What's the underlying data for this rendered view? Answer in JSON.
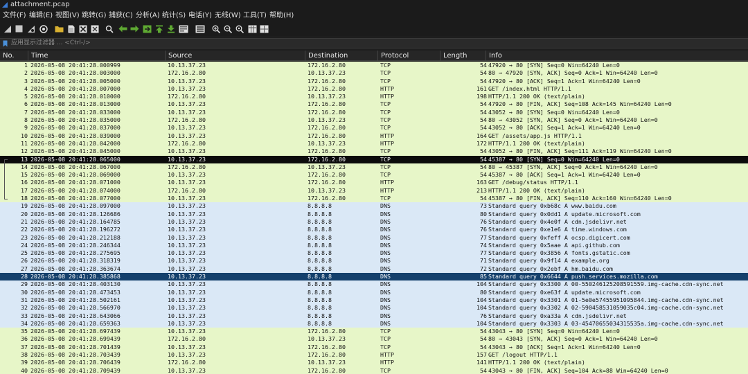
{
  "window": {
    "title": "attachment.pcap"
  },
  "menu": [
    "文件(F)",
    "编辑(E)",
    "视图(V)",
    "跳转(G)",
    "捕获(C)",
    "分析(A)",
    "统计(S)",
    "电话(Y)",
    "无线(W)",
    "工具(T)",
    "帮助(H)"
  ],
  "toolbar": {
    "icons": [
      "shark-fin-start-icon",
      "stop-icon",
      "restart-icon",
      "capture-options-icon",
      "open-folder-icon",
      "file-icon",
      "save-icon",
      "close-file-icon",
      "reload-icon",
      "find-icon",
      "back-arrow-icon",
      "forward-arrow-icon",
      "go-to-packet-icon",
      "first-packet-icon",
      "last-packet-icon",
      "autoscroll-icon",
      "colorize-icon",
      "zoom-in-icon",
      "zoom-out-icon",
      "zoom-reset-icon",
      "resize-columns-icon",
      "layout-icon"
    ],
    "colors": {
      "green": "#5ea832",
      "yellow": "#d8b030",
      "blue": "#4a90d9",
      "gray": "#c8c8c8"
    }
  },
  "filter": {
    "placeholder": "应用显示过滤器 ... <Ctrl-/>"
  },
  "columns": {
    "no": "No.",
    "time": "Time",
    "source": "Source",
    "destination": "Destination",
    "protocol": "Protocol",
    "length": "Length",
    "info": "Info"
  },
  "colors": {
    "tcp_row": "#e7f6c8",
    "dns_row": "#dae8f6",
    "selected_black": "#0b0b0b",
    "selected_blue": "#14406c"
  },
  "packets": [
    {
      "no": "1",
      "time": "2026-05-08 20:41:28.000999",
      "src": "10.13.37.23",
      "dst": "172.16.2.80",
      "proto": "TCP",
      "len": "54",
      "info": "47920 → 80 [SYN] Seq=0 Win=64240 Len=0",
      "style": "tcp"
    },
    {
      "no": "2",
      "time": "2026-05-08 20:41:28.003000",
      "src": "172.16.2.80",
      "dst": "10.13.37.23",
      "proto": "TCP",
      "len": "54",
      "info": "80 → 47920 [SYN, ACK] Seq=0 Ack=1 Win=64240 Len=0",
      "style": "tcp"
    },
    {
      "no": "3",
      "time": "2026-05-08 20:41:28.005000",
      "src": "10.13.37.23",
      "dst": "172.16.2.80",
      "proto": "TCP",
      "len": "54",
      "info": "47920 → 80 [ACK] Seq=1 Ack=1 Win=64240 Len=0",
      "style": "tcp"
    },
    {
      "no": "4",
      "time": "2026-05-08 20:41:28.007000",
      "src": "10.13.37.23",
      "dst": "172.16.2.80",
      "proto": "HTTP",
      "len": "161",
      "info": "GET /index.html HTTP/1.1",
      "style": "tcp"
    },
    {
      "no": "5",
      "time": "2026-05-08 20:41:28.010000",
      "src": "172.16.2.80",
      "dst": "10.13.37.23",
      "proto": "HTTP",
      "len": "198",
      "info": "HTTP/1.1 200 OK  (text/plain)",
      "style": "tcp"
    },
    {
      "no": "6",
      "time": "2026-05-08 20:41:28.013000",
      "src": "10.13.37.23",
      "dst": "172.16.2.80",
      "proto": "TCP",
      "len": "54",
      "info": "47920 → 80 [FIN, ACK] Seq=108 Ack=145 Win=64240 Len=0",
      "style": "tcp"
    },
    {
      "no": "7",
      "time": "2026-05-08 20:41:28.033000",
      "src": "10.13.37.23",
      "dst": "172.16.2.80",
      "proto": "TCP",
      "len": "54",
      "info": "43052 → 80 [SYN] Seq=0 Win=64240 Len=0",
      "style": "tcp"
    },
    {
      "no": "8",
      "time": "2026-05-08 20:41:28.035000",
      "src": "172.16.2.80",
      "dst": "10.13.37.23",
      "proto": "TCP",
      "len": "54",
      "info": "80 → 43052 [SYN, ACK] Seq=0 Ack=1 Win=64240 Len=0",
      "style": "tcp"
    },
    {
      "no": "9",
      "time": "2026-05-08 20:41:28.037000",
      "src": "10.13.37.23",
      "dst": "172.16.2.80",
      "proto": "TCP",
      "len": "54",
      "info": "43052 → 80 [ACK] Seq=1 Ack=1 Win=64240 Len=0",
      "style": "tcp"
    },
    {
      "no": "10",
      "time": "2026-05-08 20:41:28.039000",
      "src": "10.13.37.23",
      "dst": "172.16.2.80",
      "proto": "HTTP",
      "len": "164",
      "info": "GET /assets/app.js HTTP/1.1",
      "style": "tcp"
    },
    {
      "no": "11",
      "time": "2026-05-08 20:41:28.042000",
      "src": "172.16.2.80",
      "dst": "10.13.37.23",
      "proto": "HTTP",
      "len": "172",
      "info": "HTTP/1.1 200 OK  (text/plain)",
      "style": "tcp"
    },
    {
      "no": "12",
      "time": "2026-05-08 20:41:28.045000",
      "src": "10.13.37.23",
      "dst": "172.16.2.80",
      "proto": "TCP",
      "len": "54",
      "info": "43052 → 80 [FIN, ACK] Seq=111 Ack=119 Win=64240 Len=0",
      "style": "tcp"
    },
    {
      "no": "13",
      "time": "2026-05-08 20:41:28.065000",
      "src": "10.13.37.23",
      "dst": "172.16.2.80",
      "proto": "TCP",
      "len": "54",
      "info": "45387 → 80 [SYN] Seq=0 Win=64240 Len=0",
      "style": "sel-black"
    },
    {
      "no": "14",
      "time": "2026-05-08 20:41:28.067000",
      "src": "172.16.2.80",
      "dst": "10.13.37.23",
      "proto": "TCP",
      "len": "54",
      "info": "80 → 45387 [SYN, ACK] Seq=0 Ack=1 Win=64240 Len=0",
      "style": "tcp"
    },
    {
      "no": "15",
      "time": "2026-05-08 20:41:28.069000",
      "src": "10.13.37.23",
      "dst": "172.16.2.80",
      "proto": "TCP",
      "len": "54",
      "info": "45387 → 80 [ACK] Seq=1 Ack=1 Win=64240 Len=0",
      "style": "tcp"
    },
    {
      "no": "16",
      "time": "2026-05-08 20:41:28.071000",
      "src": "10.13.37.23",
      "dst": "172.16.2.80",
      "proto": "HTTP",
      "len": "163",
      "info": "GET /debug/status HTTP/1.1",
      "style": "tcp"
    },
    {
      "no": "17",
      "time": "2026-05-08 20:41:28.074000",
      "src": "172.16.2.80",
      "dst": "10.13.37.23",
      "proto": "HTTP",
      "len": "213",
      "info": "HTTP/1.1 200 OK  (text/plain)",
      "style": "tcp"
    },
    {
      "no": "18",
      "time": "2026-05-08 20:41:28.077000",
      "src": "10.13.37.23",
      "dst": "172.16.2.80",
      "proto": "TCP",
      "len": "54",
      "info": "45387 → 80 [FIN, ACK] Seq=110 Ack=160 Win=64240 Len=0",
      "style": "tcp"
    },
    {
      "no": "19",
      "time": "2026-05-08 20:41:28.097000",
      "src": "10.13.37.23",
      "dst": "8.8.8.8",
      "proto": "DNS",
      "len": "73",
      "info": "Standard query 0xb68c A www.baidu.com",
      "style": "dns"
    },
    {
      "no": "20",
      "time": "2026-05-08 20:41:28.126686",
      "src": "10.13.37.23",
      "dst": "8.8.8.8",
      "proto": "DNS",
      "len": "80",
      "info": "Standard query 0x0dd1 A update.microsoft.com",
      "style": "dns"
    },
    {
      "no": "21",
      "time": "2026-05-08 20:41:28.164785",
      "src": "10.13.37.23",
      "dst": "8.8.8.8",
      "proto": "DNS",
      "len": "76",
      "info": "Standard query 0x4e0f A cdn.jsdelivr.net",
      "style": "dns"
    },
    {
      "no": "22",
      "time": "2026-05-08 20:41:28.196272",
      "src": "10.13.37.23",
      "dst": "8.8.8.8",
      "proto": "DNS",
      "len": "76",
      "info": "Standard query 0xe1e6 A time.windows.com",
      "style": "dns"
    },
    {
      "no": "23",
      "time": "2026-05-08 20:41:28.212188",
      "src": "10.13.37.23",
      "dst": "8.8.8.8",
      "proto": "DNS",
      "len": "77",
      "info": "Standard query 0xfeff A ocsp.digicert.com",
      "style": "dns"
    },
    {
      "no": "24",
      "time": "2026-05-08 20:41:28.246344",
      "src": "10.13.37.23",
      "dst": "8.8.8.8",
      "proto": "DNS",
      "len": "74",
      "info": "Standard query 0x5aae A api.github.com",
      "style": "dns"
    },
    {
      "no": "25",
      "time": "2026-05-08 20:41:28.275695",
      "src": "10.13.37.23",
      "dst": "8.8.8.8",
      "proto": "DNS",
      "len": "77",
      "info": "Standard query 0x3856 A fonts.gstatic.com",
      "style": "dns"
    },
    {
      "no": "26",
      "time": "2026-05-08 20:41:28.318319",
      "src": "10.13.37.23",
      "dst": "8.8.8.8",
      "proto": "DNS",
      "len": "71",
      "info": "Standard query 0x9f14 A example.org",
      "style": "dns"
    },
    {
      "no": "27",
      "time": "2026-05-08 20:41:28.363674",
      "src": "10.13.37.23",
      "dst": "8.8.8.8",
      "proto": "DNS",
      "len": "72",
      "info": "Standard query 0x2ebf A hm.baidu.com",
      "style": "dns"
    },
    {
      "no": "28",
      "time": "2026-05-08 20:41:28.385868",
      "src": "10.13.37.23",
      "dst": "8.8.8.8",
      "proto": "DNS",
      "len": "85",
      "info": "Standard query 0x6644 A push.services.mozilla.com",
      "style": "sel-blue"
    },
    {
      "no": "29",
      "time": "2026-05-08 20:41:28.403130",
      "src": "10.13.37.23",
      "dst": "8.8.8.8",
      "proto": "DNS",
      "len": "104",
      "info": "Standard query 0x3300 A 00-550246125208591559.img-cache.cdn-sync.net",
      "style": "dns"
    },
    {
      "no": "30",
      "time": "2026-05-08 20:41:28.473453",
      "src": "10.13.37.23",
      "dst": "8.8.8.8",
      "proto": "DNS",
      "len": "80",
      "info": "Standard query 0xe63f A update.microsoft.com",
      "style": "dns"
    },
    {
      "no": "31",
      "time": "2026-05-08 20:41:28.502161",
      "src": "10.13.37.23",
      "dst": "8.8.8.8",
      "proto": "DNS",
      "len": "104",
      "info": "Standard query 0x3301 A 01-5e0e57455951095844.img-cache.cdn-sync.net",
      "style": "dns"
    },
    {
      "no": "32",
      "time": "2026-05-08 20:41:28.566970",
      "src": "10.13.37.23",
      "dst": "8.8.8.8",
      "proto": "DNS",
      "len": "104",
      "info": "Standard query 0x3302 A 02-590458531059035c04.img-cache.cdn-sync.net",
      "style": "dns"
    },
    {
      "no": "33",
      "time": "2026-05-08 20:41:28.643066",
      "src": "10.13.37.23",
      "dst": "8.8.8.8",
      "proto": "DNS",
      "len": "76",
      "info": "Standard query 0xa33a A cdn.jsdelivr.net",
      "style": "dns"
    },
    {
      "no": "34",
      "time": "2026-05-08 20:41:28.659363",
      "src": "10.13.37.23",
      "dst": "8.8.8.8",
      "proto": "DNS",
      "len": "104",
      "info": "Standard query 0x3303 A 03-45470655034315535a.img-cache.cdn-sync.net",
      "style": "dns"
    },
    {
      "no": "35",
      "time": "2026-05-08 20:41:28.697439",
      "src": "10.13.37.23",
      "dst": "172.16.2.80",
      "proto": "TCP",
      "len": "54",
      "info": "43043 → 80 [SYN] Seq=0 Win=64240 Len=0",
      "style": "tcp"
    },
    {
      "no": "36",
      "time": "2026-05-08 20:41:28.699439",
      "src": "172.16.2.80",
      "dst": "10.13.37.23",
      "proto": "TCP",
      "len": "54",
      "info": "80 → 43043 [SYN, ACK] Seq=0 Ack=1 Win=64240 Len=0",
      "style": "tcp"
    },
    {
      "no": "37",
      "time": "2026-05-08 20:41:28.701439",
      "src": "10.13.37.23",
      "dst": "172.16.2.80",
      "proto": "TCP",
      "len": "54",
      "info": "43043 → 80 [ACK] Seq=1 Ack=1 Win=64240 Len=0",
      "style": "tcp"
    },
    {
      "no": "38",
      "time": "2026-05-08 20:41:28.703439",
      "src": "10.13.37.23",
      "dst": "172.16.2.80",
      "proto": "HTTP",
      "len": "157",
      "info": "GET /logout HTTP/1.1",
      "style": "tcp"
    },
    {
      "no": "39",
      "time": "2026-05-08 20:41:28.706439",
      "src": "172.16.2.80",
      "dst": "10.13.37.23",
      "proto": "HTTP",
      "len": "141",
      "info": "HTTP/1.1 200 OK  (text/plain)",
      "style": "tcp"
    },
    {
      "no": "40",
      "time": "2026-05-08 20:41:28.709439",
      "src": "10.13.37.23",
      "dst": "172.16.2.80",
      "proto": "TCP",
      "len": "54",
      "info": "43043 → 80 [FIN, ACK] Seq=104 Ack=88 Win=64240 Len=0",
      "style": "tcp"
    }
  ]
}
